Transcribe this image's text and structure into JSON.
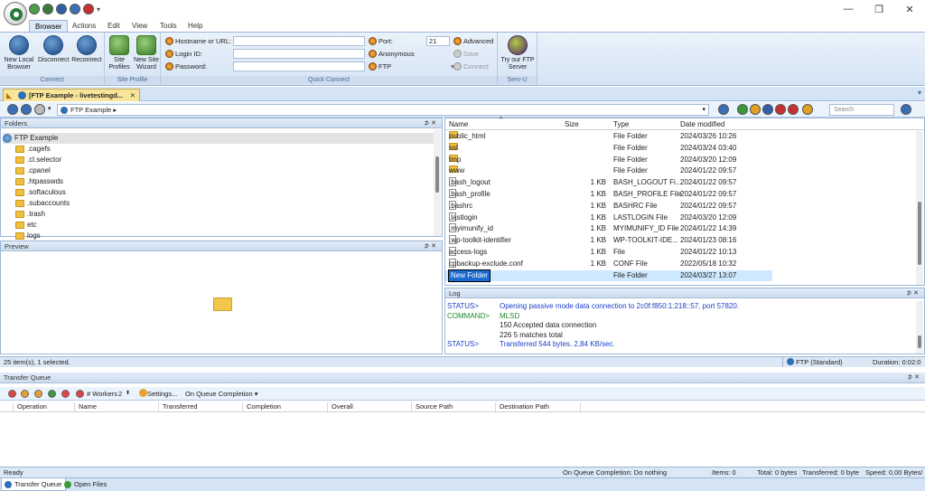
{
  "ribbon_tabs": [
    "Browser",
    "Actions",
    "Edit",
    "View",
    "Tools",
    "Help"
  ],
  "ribbon": {
    "connect": {
      "label": "Connect",
      "new_local_browser": "New Local Browser",
      "disconnect": "Disconnect",
      "reconnect": "Reconnect"
    },
    "site_profile": {
      "label": "Site Profile",
      "site_profiles": "Site Profiles",
      "new_site_wizard": "New Site Wizard"
    },
    "quick_connect": {
      "label": "Quick Connect",
      "hostname_label": "Hostname or URL:",
      "login_label": "Login ID:",
      "password_label": "Password:",
      "port_label": "Port:",
      "port_value": "21",
      "anonymous": "Anonymous",
      "protocol": "FTP",
      "advanced": "Advanced",
      "save": "Save",
      "connect": "Connect"
    },
    "servu": {
      "label": "Serv-U",
      "try_servu": "Try our FTP Server"
    }
  },
  "doc_tab": {
    "title": "[FTP Example - livetestingd..."
  },
  "address": {
    "path": "FTP Example",
    "search_placeholder": "Search"
  },
  "folders": {
    "title": "Folders",
    "root": "FTP Example",
    "items": [
      ".cagefs",
      ".cl.selector",
      ".cpanel",
      ".htpasswds",
      ".softaculous",
      ".subaccounts",
      ".trash",
      "etc",
      "logs"
    ]
  },
  "preview": {
    "title": "Preview"
  },
  "files": {
    "columns": {
      "name": "Name",
      "size": "Size",
      "type": "Type",
      "date": "Date modified"
    },
    "rows": [
      {
        "name": "public_html",
        "size": "",
        "type": "File Folder",
        "date": "2024/03/26 10:26",
        "icon": "folder"
      },
      {
        "name": "ssl",
        "size": "",
        "type": "File Folder",
        "date": "2024/03/24 03:40",
        "icon": "folder"
      },
      {
        "name": "tmp",
        "size": "",
        "type": "File Folder",
        "date": "2024/03/20 12:09",
        "icon": "folder"
      },
      {
        "name": "www",
        "size": "",
        "type": "File Folder",
        "date": "2024/01/22 09:57",
        "icon": "folder"
      },
      {
        "name": ".bash_logout",
        "size": "1 KB",
        "type": "BASH_LOGOUT Fi...",
        "date": "2024/01/22 09:57",
        "icon": "file"
      },
      {
        "name": ".bash_profile",
        "size": "1 KB",
        "type": "BASH_PROFILE File",
        "date": "2024/01/22 09:57",
        "icon": "file"
      },
      {
        "name": ".bashrc",
        "size": "1 KB",
        "type": "BASHRC File",
        "date": "2024/01/22 09:57",
        "icon": "file"
      },
      {
        "name": ".lastlogin",
        "size": "1 KB",
        "type": "LASTLOGIN File",
        "date": "2024/03/20 12:09",
        "icon": "file"
      },
      {
        "name": ".myimunify_id",
        "size": "1 KB",
        "type": "MYIMUNIFY_ID File",
        "date": "2024/01/22 14:39",
        "icon": "file"
      },
      {
        "name": ".wp-toolkit-identifier",
        "size": "1 KB",
        "type": "WP-TOOLKIT-IDE...",
        "date": "2024/01/23 08:16",
        "icon": "file"
      },
      {
        "name": "access-logs",
        "size": "1 KB",
        "type": "File",
        "date": "2024/01/22 10:13",
        "icon": "file"
      },
      {
        "name": "cpbackup-exclude.conf",
        "size": "1 KB",
        "type": "CONF File",
        "date": "2022/05/18 10:32",
        "icon": "file"
      },
      {
        "name": "New Folder",
        "size": "",
        "type": "File Folder",
        "date": "2024/03/27 13:07",
        "icon": "folder",
        "selected": true
      }
    ]
  },
  "log": {
    "title": "Log",
    "lines": [
      {
        "key": "STATUS>",
        "text": "Opening passive mode data connection to 2c0f:f850:1:218::57, port 57820.",
        "color": "#1a3fc8"
      },
      {
        "key": "COMMAND>",
        "text": "MLSD",
        "color": "#1e8a2e"
      },
      {
        "key": "",
        "text": "150 Accepted data connection",
        "color": "#222222"
      },
      {
        "key": "",
        "text": "226 5 matches total",
        "color": "#222222"
      },
      {
        "key": "STATUS>",
        "text": "Transferred 544 bytes. 2,84 KB/sec.",
        "color": "#1a3fc8"
      }
    ]
  },
  "status1": {
    "left": "25 item(s), 1 selected.",
    "protocol": "FTP (Standard)",
    "duration": "Duration: 0:02:0"
  },
  "transfer_queue": {
    "title": "Transfer Queue",
    "workers_label": "# Workers",
    "workers_value": "2",
    "settings": "Settings...",
    "on_queue_completion": "On Queue Completion",
    "columns": [
      "Operation",
      "Name",
      "Transferred",
      "Completion",
      "Overall",
      "Source Path",
      "Destination Path"
    ]
  },
  "status2": {
    "ready": "Ready",
    "on_queue": "On Queue Completion: Do nothing",
    "items": "Items: 0",
    "total": "Total: 0 bytes",
    "transferred": "Transferred: 0 byte",
    "speed": "Speed: 0,00 Bytes/"
  },
  "bottom_tabs": [
    "Transfer Queue",
    "Open Files"
  ]
}
